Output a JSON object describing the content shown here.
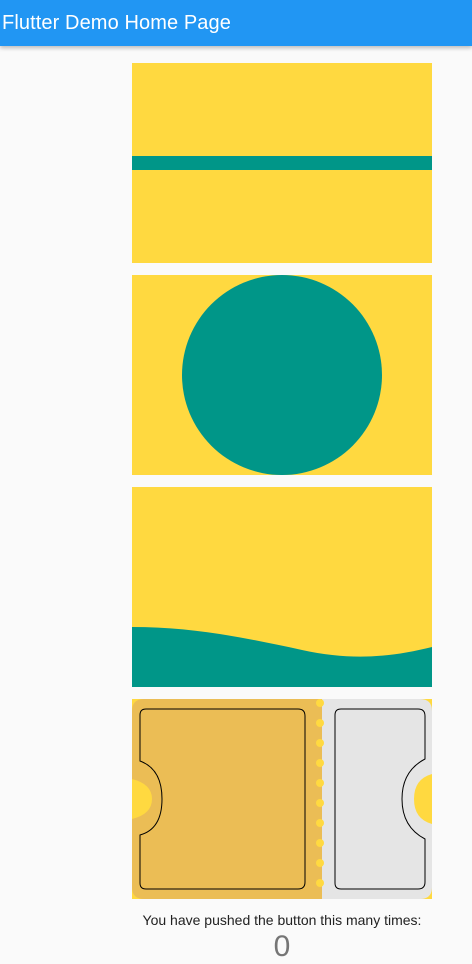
{
  "appbar": {
    "title": "Flutter Demo Home Page",
    "color": "#2196f3"
  },
  "colors": {
    "yellow": "#ffd940",
    "teal": "#009688",
    "ticket_left": "#ebbd55",
    "ticket_right": "#e5e5e5",
    "background": "#fafafa"
  },
  "panels": [
    {
      "shape": "horizontal-stripe"
    },
    {
      "shape": "circle"
    },
    {
      "shape": "wave"
    },
    {
      "shape": "ticket"
    }
  ],
  "counter": {
    "label": "You have pushed the button this many times:",
    "value": "0"
  }
}
